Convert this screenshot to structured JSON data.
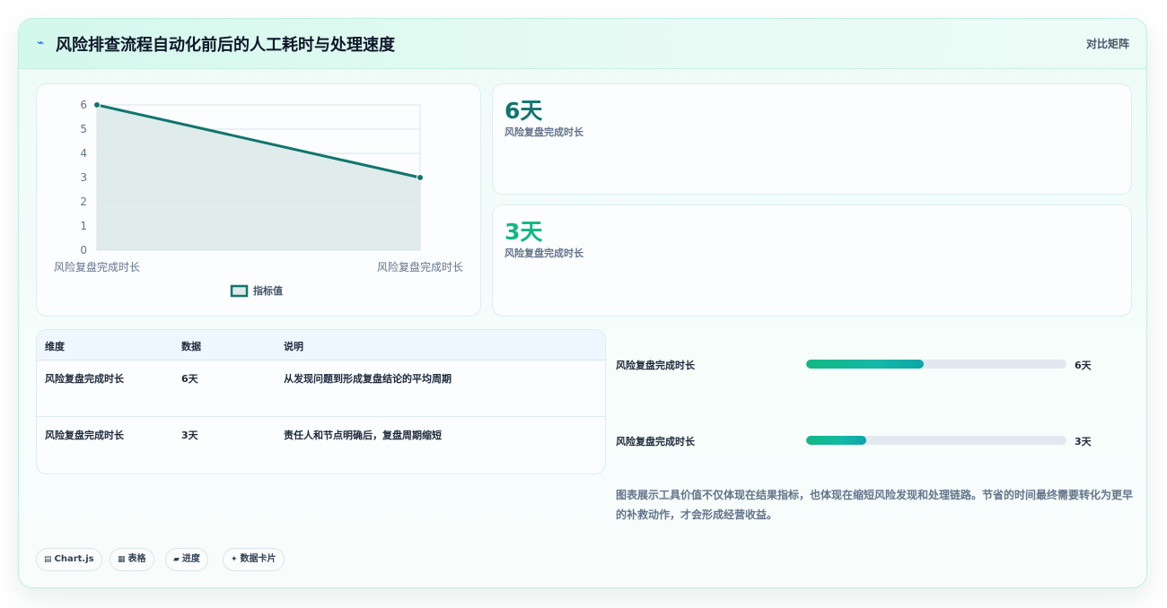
{
  "header": {
    "title_icon": "⌁",
    "title": "风险排查流程自动化前后的人工耗时与处理速度",
    "mode": "对比矩阵"
  },
  "chart_data": {
    "type": "line",
    "categories": [
      "风险复盘完成时长",
      "风险复盘完成时长"
    ],
    "series": [
      {
        "name": "指标值",
        "values": [
          6,
          3
        ]
      }
    ],
    "ylim": [
      0,
      6
    ],
    "yticks": [
      "0",
      "1",
      "2",
      "3",
      "4",
      "5",
      "6"
    ],
    "legend": "bottom",
    "grid": true,
    "colors": {
      "line": "#12766c",
      "fill": "#dceae9"
    }
  },
  "stats": [
    {
      "value": "6天",
      "label": "风险复盘完成时长"
    },
    {
      "value": "3天",
      "label": "风险复盘完成时长"
    }
  ],
  "table": {
    "headers": [
      "维度",
      "数据",
      "说明"
    ],
    "rows": [
      [
        "风险复盘完成时长",
        "6天",
        "从发现问题到形成复盘结论的平均周期"
      ],
      [
        "风险复盘完成时长",
        "3天",
        "责任人和节点明确后，复盘周期缩短"
      ]
    ]
  },
  "bars": [
    {
      "label": "风险复盘完成时长",
      "value": "6天",
      "fraction": 0.45
    },
    {
      "label": "风险复盘完成时长",
      "value": "3天",
      "fraction": 0.23
    }
  ],
  "note": "图表展示工具价值不仅体现在结果指标，也体现在缩短风险发现和处理链路。节省的时间最终需要转化为更早的补救动作，才会形成经营收益。",
  "chips": [
    {
      "icon": "▤",
      "label": "Chart.js"
    },
    {
      "icon": "▦",
      "label": "表格"
    },
    {
      "icon": "▰",
      "label": "进度"
    },
    {
      "icon": "✦",
      "label": "数据卡片"
    }
  ]
}
